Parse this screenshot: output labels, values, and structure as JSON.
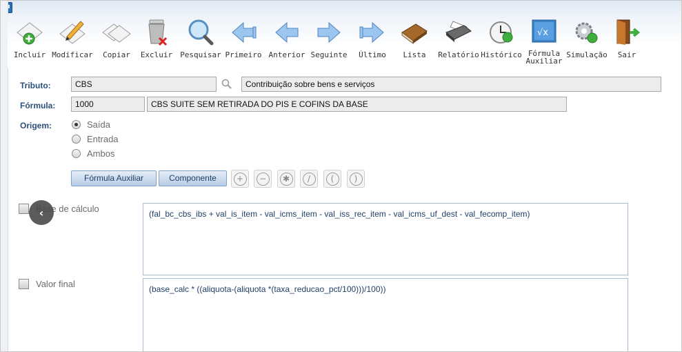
{
  "toolbar": {
    "items": [
      {
        "label": "Incluir",
        "icon": "add-icon"
      },
      {
        "label": "Modificar",
        "icon": "edit-icon"
      },
      {
        "label": "Copiar",
        "icon": "copy-icon"
      },
      {
        "label": "Excluir",
        "icon": "trash-icon"
      },
      {
        "label": "Pesquisar",
        "icon": "magnifier-icon"
      },
      {
        "label": "Primeiro",
        "icon": "first-arrow-icon"
      },
      {
        "label": "Anterior",
        "icon": "previous-arrow-icon"
      },
      {
        "label": "Seguinte",
        "icon": "next-arrow-icon"
      },
      {
        "label": "Último",
        "icon": "last-arrow-icon"
      },
      {
        "label": "Lista",
        "icon": "book-icon"
      },
      {
        "label": "Relatório",
        "icon": "printer-icon"
      },
      {
        "label": "Histórico",
        "icon": "history-icon"
      },
      {
        "label": "Fórmula\nAuxiliar",
        "icon": "formula-icon"
      },
      {
        "label": "Simulação",
        "icon": "gears-icon"
      },
      {
        "label": "Sair",
        "icon": "exit-door-icon"
      }
    ]
  },
  "form": {
    "tributo_label": "Tributo:",
    "tributo_code": "CBS",
    "tributo_desc": "Contribuição sobre bens e serviços",
    "formula_label": "Fórmula:",
    "formula_code": "1000",
    "formula_desc": "CBS SUITE SEM RETIRADA DO PIS E COFINS DA BASE",
    "origem_label": "Origem:",
    "origem_options": [
      "Saída",
      "Entrada",
      "Ambos"
    ],
    "origem_selected": "Saída"
  },
  "buttons": {
    "formula_auxiliar": "Fórmula Auxiliar",
    "componente": "Componente",
    "operators": [
      "+",
      "−",
      "✱",
      "/",
      "(",
      ")"
    ]
  },
  "sections": {
    "base_label": "Base de cálculo",
    "base_expr": "(fal_bc_cbs_ibs + val_is_item - val_icms_item - val_iss_rec_item - val_icms_uf_dest - val_fecomp_item)",
    "final_label": "Valor final",
    "final_expr": "(base_calc * ((aliquota-(aliquota *(taxa_reducao_pct/100)))/100))"
  },
  "colors": {
    "label_blue": "#2b4f7a",
    "accent": "#2f6fb3"
  }
}
